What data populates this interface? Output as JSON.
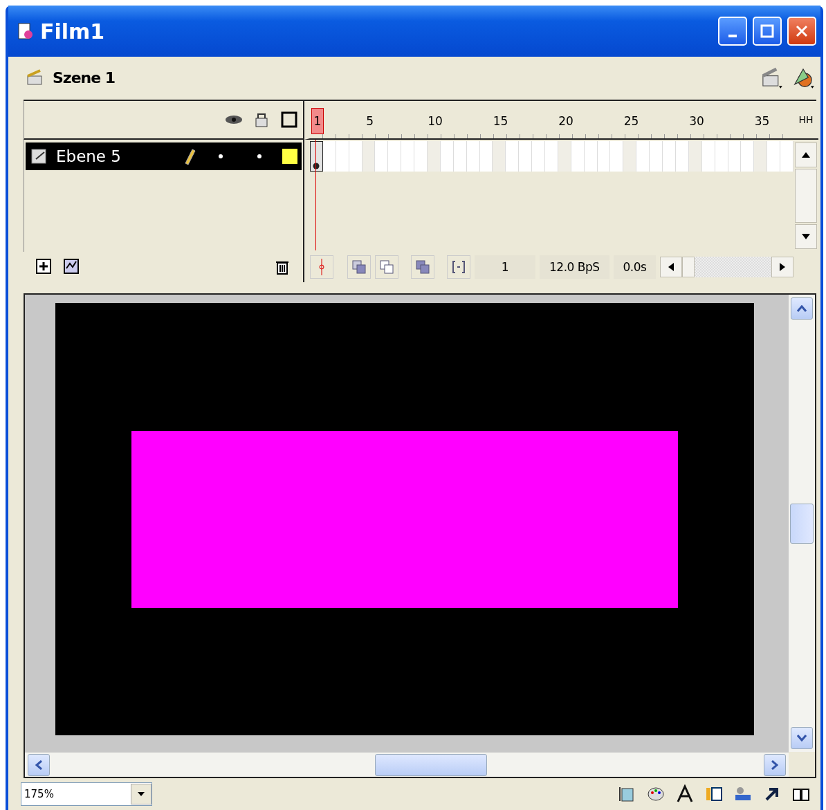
{
  "window": {
    "title": "Film1"
  },
  "scene": {
    "label": "Szene 1"
  },
  "timeline": {
    "ruler": [
      {
        "label": "1",
        "selected": true
      },
      {
        "label": "5",
        "selected": false
      },
      {
        "label": "10",
        "selected": false
      },
      {
        "label": "15",
        "selected": false
      },
      {
        "label": "20",
        "selected": false
      },
      {
        "label": "25",
        "selected": false
      },
      {
        "label": "30",
        "selected": false
      },
      {
        "label": "35",
        "selected": false
      }
    ],
    "view_button": "HH",
    "layers": [
      {
        "name": "Ebene 5",
        "selected": true,
        "editing": true,
        "hidden": false,
        "locked": false,
        "outline_only": false,
        "color": "#ffff44"
      }
    ],
    "current_frame": "1",
    "frame_rate": "12.0 BpS",
    "elapsed": "0.0s"
  },
  "status_bar": {
    "zoom": "175%"
  }
}
